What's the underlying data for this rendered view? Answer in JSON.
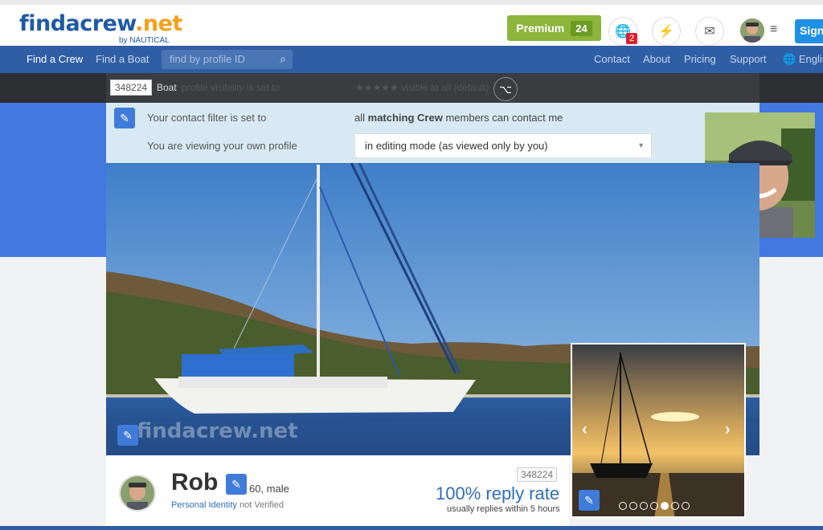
{
  "header": {
    "logo_main": "findacrew",
    "logo_dot": ".",
    "logo_net": "net",
    "logo_sub": "by NAUTICAL",
    "premium_label": "Premium",
    "premium_count": "24",
    "notification_count": "2",
    "signin_label": "Sign"
  },
  "nav": {
    "find_crew": "Find a Crew",
    "find_boat": "Find a Boat",
    "search_placeholder": "find by profile ID",
    "contact": "Contact",
    "about": "About",
    "pricing": "Pricing",
    "support": "Support",
    "language": "Englis"
  },
  "visibility_bar": {
    "profile_id": "348224",
    "type": "Boat",
    "obscured_text": "profile visibility is set to",
    "obscured_value": "★★★★★ visible to all (default)"
  },
  "filter": {
    "contact_label": "Your contact filter is set to",
    "contact_value_prefix": "all",
    "contact_value_bold": "matching Crew",
    "contact_value_suffix": "members can contact me",
    "viewing_label": "You are viewing your own profile",
    "viewing_mode": "in editing mode (as viewed only by you)"
  },
  "photo": {
    "watermark": "findacrew.net"
  },
  "profile": {
    "name": "Rob",
    "age_gender": "60, male",
    "identity_link": "Personal Identity",
    "identity_status": "not Verified",
    "profile_id": "348224",
    "reply_rate": "100% reply rate",
    "reply_sub": "usually replies within 5 hours"
  },
  "gallery": {
    "dot_count": 7,
    "active_index": 4
  },
  "icons": {
    "notifications": "globe-icon",
    "activity": "bolt-icon",
    "messages": "envelope-icon",
    "menu": "hamburger-icon",
    "share": "share-icon",
    "edit": "pencil-icon",
    "search": "search-icon"
  },
  "colors": {
    "brand_blue": "#2f5ea4",
    "accent_orange": "#f5a01a",
    "premium_green": "#8bb63b",
    "link_blue": "#2f6fb7",
    "edit_blue": "#3f7bd8"
  }
}
